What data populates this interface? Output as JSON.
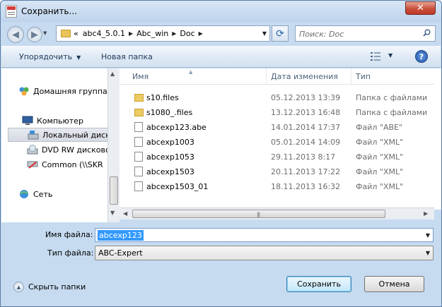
{
  "window": {
    "title": "Сохранить...",
    "close_glyph": "✕"
  },
  "address": {
    "overflow_glyph": "«",
    "crumbs": [
      "abc4_5.0.1",
      "Abc_win",
      "Doc"
    ]
  },
  "search": {
    "placeholder": "Поиск: Doc"
  },
  "toolbar": {
    "organize_label": "Упорядочить",
    "new_folder_label": "Новая папка",
    "help_glyph": "?"
  },
  "nav": {
    "items": [
      {
        "label": "Домашняя группа",
        "icon": "homegroup-icon"
      },
      {
        "label": "Компьютер",
        "icon": "computer-icon"
      },
      {
        "label": "Локальный диск",
        "icon": "local-disk-icon"
      },
      {
        "label": "DVD RW дисковод",
        "icon": "dvd-icon"
      },
      {
        "label": "Common (\\\\SKR",
        "icon": "network-drive-icon"
      },
      {
        "label": "Сеть",
        "icon": "network-icon"
      }
    ]
  },
  "files": {
    "columns": {
      "name": "Имя",
      "date": "Дата изменения",
      "type": "Тип"
    },
    "rows": [
      {
        "name": "s10.files",
        "date": "05.12.2013 13:39",
        "type": "Папка с файлами",
        "kind": "folder"
      },
      {
        "name": "s1080_.files",
        "date": "13.12.2013 16:48",
        "type": "Папка с файлами",
        "kind": "folder"
      },
      {
        "name": "abcexp123.abe",
        "date": "14.01.2014 17:37",
        "type": "Файл \"ABE\"",
        "kind": "file"
      },
      {
        "name": "abcexp1003",
        "date": "05.01.2014 14:09",
        "type": "Файл \"XML\"",
        "kind": "file"
      },
      {
        "name": "abcexp1053",
        "date": "29.11.2013 8:17",
        "type": "Файл \"XML\"",
        "kind": "file"
      },
      {
        "name": "abcexp1503",
        "date": "20.11.2013 17:22",
        "type": "Файл \"XML\"",
        "kind": "file"
      },
      {
        "name": "abcexp1503_01",
        "date": "18.11.2013 16:32",
        "type": "Файл \"XML\"",
        "kind": "file"
      }
    ]
  },
  "form": {
    "filename_label": "Имя файла:",
    "filename_value": "abcexp123",
    "filetype_label": "Тип файла:",
    "filetype_value": "ABC-Expert"
  },
  "footer": {
    "hide_folders_label": "Скрыть папки",
    "save_label": "Сохранить",
    "cancel_label": "Отмена"
  },
  "colors": {
    "accent": "#3399ff",
    "chrome": "#c6dbf0",
    "close": "#c0392b"
  }
}
